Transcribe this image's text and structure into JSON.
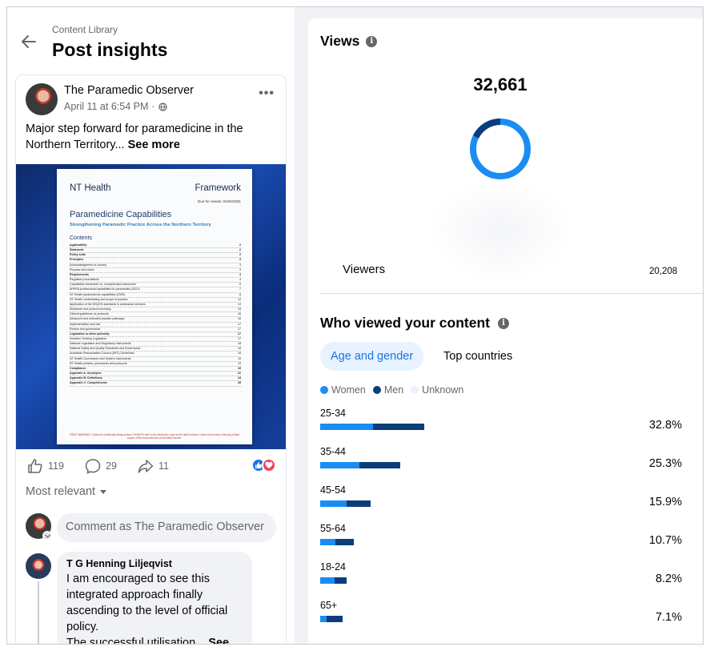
{
  "header": {
    "breadcrumb": "Content Library",
    "title": "Post insights"
  },
  "post": {
    "author": "The Paramedic Observer",
    "date": "April 11 at 6:54 PM",
    "separator": "·",
    "text": "Major step forward for paramedicine in the Northern Territory...",
    "see_more": "See more",
    "image": {
      "org": "NT Health",
      "doc_type": "Framework",
      "due": "Due for review: 04/02/2031",
      "title": "Paramedicine Capabilities",
      "subtitle": "Strengthening Paramedic Practice Across the Northern Territory",
      "contents_label": "Contents",
      "toc": [
        {
          "t": "Applicability",
          "p": "2",
          "b": true
        },
        {
          "t": "Statement",
          "p": "2",
          "b": true
        },
        {
          "t": "Policy suite",
          "p": "2",
          "b": true
        },
        {
          "t": "Principles",
          "p": "3",
          "b": true
        },
        {
          "t": "Acknowledgement of country",
          "p": "3",
          "b": false
        },
        {
          "t": "Purpose and vision",
          "p": "3",
          "b": false
        },
        {
          "t": "Requirements",
          "p": "4",
          "b": true
        },
        {
          "t": "Regulatory foundations",
          "p": "4",
          "b": false
        },
        {
          "t": "Capabilities framework vs. competencies framework",
          "p": "6",
          "b": false
        },
        {
          "t": "AHPRA professional capabilities for paramedics (2021)",
          "p": "7",
          "b": false
        },
        {
          "t": "NT Health paramedicine capabilities (2025)",
          "p": "8",
          "b": false
        },
        {
          "t": "NT Health credentialing and scope of practice",
          "p": "12",
          "b": false
        },
        {
          "t": "Application of the NSQHS standards in ambulance services",
          "p": "13",
          "b": false
        },
        {
          "t": "Medicines and poisons licensing",
          "p": "15",
          "b": false
        },
        {
          "t": "Clinical guidelines vs protocols",
          "p": "16",
          "b": false
        },
        {
          "t": "Advanced and extended practice pathways",
          "p": "16",
          "b": false
        },
        {
          "t": "Implementation and use",
          "p": "17",
          "b": false
        },
        {
          "t": "Review and governance",
          "p": "17",
          "b": false
        },
        {
          "t": "Legislative or other authority",
          "p": "17",
          "b": true
        },
        {
          "t": "Northern Territory Legislation",
          "p": "17",
          "b": false
        },
        {
          "t": "National Legislation and Regulatory Instruments",
          "p": "18",
          "b": false
        },
        {
          "t": "National Safety and Quality Standards and Governance",
          "p": "18",
          "b": false
        },
        {
          "t": "Australian Resuscitation Council (ARC) Guidelines",
          "p": "18",
          "b": false
        },
        {
          "t": "NT Health Governance and System Instruments",
          "p": "19",
          "b": false
        },
        {
          "t": "NT Health policies, procedures and protocols",
          "p": "19",
          "b": false
        },
        {
          "t": "Compliance",
          "p": "19",
          "b": true
        },
        {
          "t": "Appendix A: Acronyms",
          "p": "22",
          "b": true
        },
        {
          "t": "Appendix B: Definitions",
          "p": "24",
          "b": true
        },
        {
          "t": "Appendix C: Competencies",
          "p": "28",
          "b": true
        }
      ],
      "footer": "PRINT WARNING: Content is continually being revised. NCAHPS refer to the electronic copy for the latest version. Users must ensure that any printed copies of this document are of the latest version."
    },
    "likes": "119",
    "comments": "29",
    "shares": "11"
  },
  "comments": {
    "sort_label": "Most relevant",
    "input_placeholder": "Comment as The Paramedic Observer",
    "items": [
      {
        "name": "T G Henning Liljeqvist",
        "text": "I am encouraged to see this integrated approach finally ascending to the level of official policy.",
        "text2": "The successful utilisation...",
        "see_more": "See"
      }
    ]
  },
  "views": {
    "title": "Views",
    "total": "32,661",
    "viewers_label": "Viewers",
    "viewers_value": "20,208"
  },
  "audience": {
    "title": "Who viewed your content",
    "tabs": [
      "Age and gender",
      "Top countries"
    ],
    "legend": [
      {
        "label": "Women",
        "color": "#1b8df2"
      },
      {
        "label": "Men",
        "color": "#0b3d7a"
      },
      {
        "label": "Unknown",
        "color": "#e7f3ff"
      }
    ],
    "age_groups": [
      {
        "label": "25-34",
        "pct": "32.8%",
        "women": 0.51,
        "men": 0.49
      },
      {
        "label": "35-44",
        "pct": "25.3%",
        "women": 0.49,
        "men": 0.51
      },
      {
        "label": "45-54",
        "pct": "15.9%",
        "women": 0.52,
        "men": 0.48
      },
      {
        "label": "55-64",
        "pct": "10.7%",
        "women": 0.44,
        "men": 0.56
      },
      {
        "label": "18-24",
        "pct": "8.2%",
        "women": 0.55,
        "men": 0.45
      },
      {
        "label": "65+",
        "pct": "7.1%",
        "women": 0.3,
        "men": 0.7
      }
    ]
  },
  "colors": {
    "accent": "#1b74e4",
    "women": "#1b8df2",
    "men": "#0b3d7a"
  }
}
